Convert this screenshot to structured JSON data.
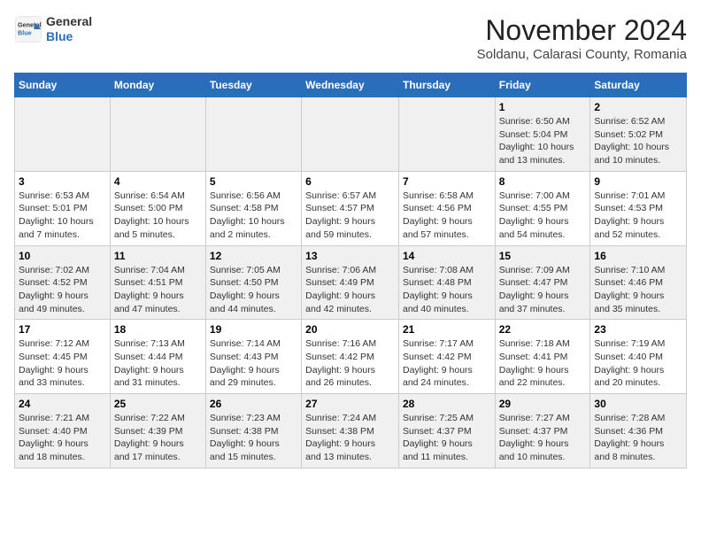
{
  "header": {
    "logo_line1": "General",
    "logo_line2": "Blue",
    "month_year": "November 2024",
    "location": "Soldanu, Calarasi County, Romania"
  },
  "weekdays": [
    "Sunday",
    "Monday",
    "Tuesday",
    "Wednesday",
    "Thursday",
    "Friday",
    "Saturday"
  ],
  "weeks": [
    [
      {
        "day": "",
        "info": ""
      },
      {
        "day": "",
        "info": ""
      },
      {
        "day": "",
        "info": ""
      },
      {
        "day": "",
        "info": ""
      },
      {
        "day": "",
        "info": ""
      },
      {
        "day": "1",
        "info": "Sunrise: 6:50 AM\nSunset: 5:04 PM\nDaylight: 10 hours\nand 13 minutes."
      },
      {
        "day": "2",
        "info": "Sunrise: 6:52 AM\nSunset: 5:02 PM\nDaylight: 10 hours\nand 10 minutes."
      }
    ],
    [
      {
        "day": "3",
        "info": "Sunrise: 6:53 AM\nSunset: 5:01 PM\nDaylight: 10 hours\nand 7 minutes."
      },
      {
        "day": "4",
        "info": "Sunrise: 6:54 AM\nSunset: 5:00 PM\nDaylight: 10 hours\nand 5 minutes."
      },
      {
        "day": "5",
        "info": "Sunrise: 6:56 AM\nSunset: 4:58 PM\nDaylight: 10 hours\nand 2 minutes."
      },
      {
        "day": "6",
        "info": "Sunrise: 6:57 AM\nSunset: 4:57 PM\nDaylight: 9 hours\nand 59 minutes."
      },
      {
        "day": "7",
        "info": "Sunrise: 6:58 AM\nSunset: 4:56 PM\nDaylight: 9 hours\nand 57 minutes."
      },
      {
        "day": "8",
        "info": "Sunrise: 7:00 AM\nSunset: 4:55 PM\nDaylight: 9 hours\nand 54 minutes."
      },
      {
        "day": "9",
        "info": "Sunrise: 7:01 AM\nSunset: 4:53 PM\nDaylight: 9 hours\nand 52 minutes."
      }
    ],
    [
      {
        "day": "10",
        "info": "Sunrise: 7:02 AM\nSunset: 4:52 PM\nDaylight: 9 hours\nand 49 minutes."
      },
      {
        "day": "11",
        "info": "Sunrise: 7:04 AM\nSunset: 4:51 PM\nDaylight: 9 hours\nand 47 minutes."
      },
      {
        "day": "12",
        "info": "Sunrise: 7:05 AM\nSunset: 4:50 PM\nDaylight: 9 hours\nand 44 minutes."
      },
      {
        "day": "13",
        "info": "Sunrise: 7:06 AM\nSunset: 4:49 PM\nDaylight: 9 hours\nand 42 minutes."
      },
      {
        "day": "14",
        "info": "Sunrise: 7:08 AM\nSunset: 4:48 PM\nDaylight: 9 hours\nand 40 minutes."
      },
      {
        "day": "15",
        "info": "Sunrise: 7:09 AM\nSunset: 4:47 PM\nDaylight: 9 hours\nand 37 minutes."
      },
      {
        "day": "16",
        "info": "Sunrise: 7:10 AM\nSunset: 4:46 PM\nDaylight: 9 hours\nand 35 minutes."
      }
    ],
    [
      {
        "day": "17",
        "info": "Sunrise: 7:12 AM\nSunset: 4:45 PM\nDaylight: 9 hours\nand 33 minutes."
      },
      {
        "day": "18",
        "info": "Sunrise: 7:13 AM\nSunset: 4:44 PM\nDaylight: 9 hours\nand 31 minutes."
      },
      {
        "day": "19",
        "info": "Sunrise: 7:14 AM\nSunset: 4:43 PM\nDaylight: 9 hours\nand 29 minutes."
      },
      {
        "day": "20",
        "info": "Sunrise: 7:16 AM\nSunset: 4:42 PM\nDaylight: 9 hours\nand 26 minutes."
      },
      {
        "day": "21",
        "info": "Sunrise: 7:17 AM\nSunset: 4:42 PM\nDaylight: 9 hours\nand 24 minutes."
      },
      {
        "day": "22",
        "info": "Sunrise: 7:18 AM\nSunset: 4:41 PM\nDaylight: 9 hours\nand 22 minutes."
      },
      {
        "day": "23",
        "info": "Sunrise: 7:19 AM\nSunset: 4:40 PM\nDaylight: 9 hours\nand 20 minutes."
      }
    ],
    [
      {
        "day": "24",
        "info": "Sunrise: 7:21 AM\nSunset: 4:40 PM\nDaylight: 9 hours\nand 18 minutes."
      },
      {
        "day": "25",
        "info": "Sunrise: 7:22 AM\nSunset: 4:39 PM\nDaylight: 9 hours\nand 17 minutes."
      },
      {
        "day": "26",
        "info": "Sunrise: 7:23 AM\nSunset: 4:38 PM\nDaylight: 9 hours\nand 15 minutes."
      },
      {
        "day": "27",
        "info": "Sunrise: 7:24 AM\nSunset: 4:38 PM\nDaylight: 9 hours\nand 13 minutes."
      },
      {
        "day": "28",
        "info": "Sunrise: 7:25 AM\nSunset: 4:37 PM\nDaylight: 9 hours\nand 11 minutes."
      },
      {
        "day": "29",
        "info": "Sunrise: 7:27 AM\nSunset: 4:37 PM\nDaylight: 9 hours\nand 10 minutes."
      },
      {
        "day": "30",
        "info": "Sunrise: 7:28 AM\nSunset: 4:36 PM\nDaylight: 9 hours\nand 8 minutes."
      }
    ]
  ]
}
